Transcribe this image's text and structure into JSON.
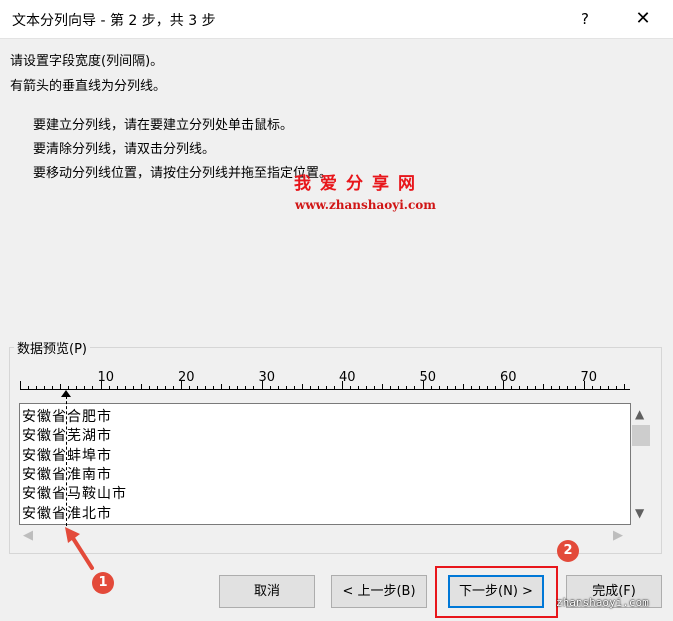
{
  "window": {
    "title": "文本分列向导 - 第 2 步，共 3 步",
    "help": "?",
    "close": "✕"
  },
  "instructions": {
    "line1": "请设置字段宽度(列间隔)。",
    "line2": "有箭头的垂直线为分列线。",
    "tip1": "要建立分列线，请在要建立分列处单击鼠标。",
    "tip2": "要清除分列线，请双击分列线。",
    "tip3": "要移动分列线位置，请按住分列线并拖至指定位置。"
  },
  "watermark": {
    "cn": "我爱分享网",
    "url": "www.zhanshaoyi.com",
    "corner": "zhanshaoyi.com"
  },
  "preview": {
    "label": "数据预览(P)",
    "ruler": [
      "10",
      "20",
      "30",
      "40",
      "50",
      "60",
      "70"
    ],
    "rows": [
      "安徽省合肥市",
      "安徽省芜湖市",
      "安徽省蚌埠市",
      "安徽省淮南市",
      "安徽省马鞍山市",
      "安徽省淮北市"
    ]
  },
  "scroll_glyphs": {
    "up": "▲",
    "down": "▼",
    "left": "◀",
    "right": "▶"
  },
  "buttons": {
    "cancel": "取消",
    "back": "< 上一步(B)",
    "next": "下一步(N) >",
    "finish": "完成(F)"
  },
  "annotations": {
    "badge1": "1",
    "badge2": "2"
  },
  "colors": {
    "highlight": "#e8161b",
    "badge": "#e34a3a",
    "focus": "#0078d7"
  }
}
